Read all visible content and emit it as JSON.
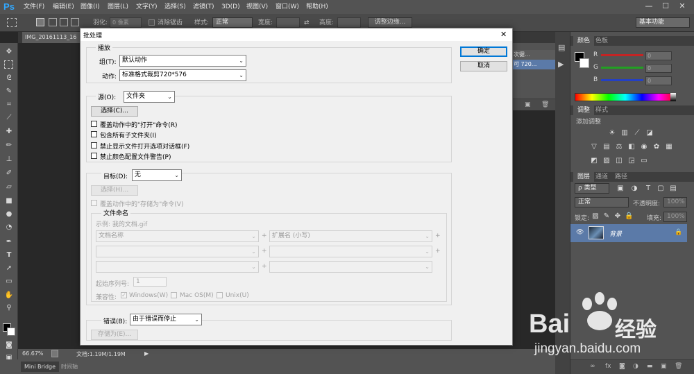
{
  "app": {
    "logo": "Ps",
    "menus": [
      "文件(F)",
      "编辑(E)",
      "图像(I)",
      "图层(L)",
      "文字(Y)",
      "选择(S)",
      "滤镜(T)",
      "3D(D)",
      "视图(V)",
      "窗口(W)",
      "帮助(H)"
    ],
    "window_controls": [
      "—",
      "☐",
      "✕"
    ]
  },
  "options_bar": {
    "feather_label": "羽化:",
    "feather_value": "0 像素",
    "antialias_label": "消除锯齿",
    "style_label": "样式:",
    "style_value": "正常",
    "width_label": "宽度:",
    "height_label": "高度:",
    "refine_button": "调整边缘...",
    "workspace": "基本功能"
  },
  "document": {
    "tab_title": "IMG_20161113_16",
    "zoom": "66.67%",
    "doc_info": "文档:1.19M/1.19M"
  },
  "bottom_tabs": [
    "Mini Bridge",
    "时间轴"
  ],
  "actions_peek": {
    "line1": "次键...",
    "line2": "可 720..."
  },
  "color_panel": {
    "tabs": [
      "颜色",
      "色板"
    ],
    "channels": [
      {
        "label": "R",
        "value": "0",
        "color": "#e03030"
      },
      {
        "label": "G",
        "value": "0",
        "color": "#30c030"
      },
      {
        "label": "B",
        "value": "0",
        "color": "#3050e0"
      }
    ]
  },
  "adjustments_panel": {
    "tabs": [
      "调整",
      "样式"
    ],
    "add_label": "添加调整"
  },
  "layers_panel": {
    "tabs": [
      "图层",
      "通道",
      "路径"
    ],
    "filter_label": "ρ 类型",
    "blend_mode": "正常",
    "opacity_label": "不透明度:",
    "opacity_value": "100%",
    "lock_label": "锁定:",
    "fill_label": "填充:",
    "fill_value": "100%",
    "layer_name": "背景"
  },
  "dialog": {
    "title": "批处理",
    "close": "✕",
    "ok": "确定",
    "cancel": "取消",
    "play": {
      "legend": "播放",
      "group_label": "组(T):",
      "group_value": "默认动作",
      "action_label": "动作:",
      "action_value": "标准格式裁剪720*576"
    },
    "source": {
      "label": "源(O):",
      "value": "文件夹",
      "choose": "选择(C)...",
      "checkboxes": [
        "覆盖动作中的\"打开\"命令(R)",
        "包含所有子文件夹(I)",
        "禁止显示文件打开选项对话框(F)",
        "禁止颜色配置文件警告(P)"
      ]
    },
    "destination": {
      "label": "目标(D):",
      "value": "无",
      "choose": "选择(H)...",
      "override": "覆盖动作中的\"存储为\"命令(V)",
      "naming_legend": "文件命名",
      "example": "示例: 我的文档.gif",
      "field1": "文档名称",
      "field2": "扩展名 (小写)",
      "plus": "+",
      "serial_label": "起始序列号:",
      "serial_value": "1",
      "compat_label": "兼容性:",
      "compat": [
        "Windows(W)",
        "Mac OS(M)",
        "Unix(U)"
      ]
    },
    "errors": {
      "label": "错误(B):",
      "value": "由于错误而停止",
      "save_as": "存储为(E)..."
    }
  },
  "watermark": {
    "brand": "Bai",
    "brand2": "经验",
    "url": "jingyan.baidu.com"
  }
}
